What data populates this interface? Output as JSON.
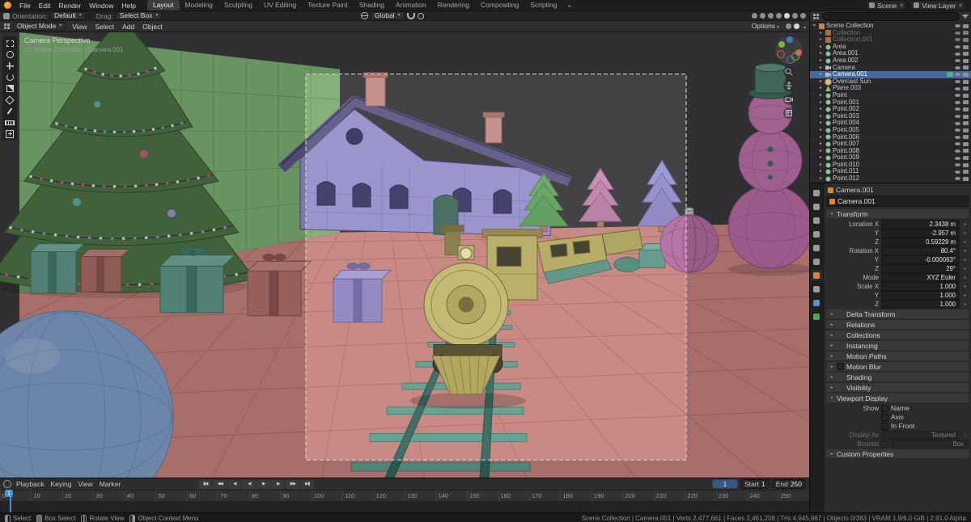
{
  "topbar": {
    "menus": [
      {
        "label": "File"
      },
      {
        "label": "Edit"
      },
      {
        "label": "Render"
      },
      {
        "label": "Window"
      },
      {
        "label": "Help"
      }
    ],
    "workspaces": [
      {
        "label": "Layout",
        "cls": "active"
      },
      {
        "label": "Modeling",
        "cls": ""
      },
      {
        "label": "Sculpting",
        "cls": ""
      },
      {
        "label": "UV Editing",
        "cls": ""
      },
      {
        "label": "Texture Paint",
        "cls": ""
      },
      {
        "label": "Shading",
        "cls": ""
      },
      {
        "label": "Animation",
        "cls": ""
      },
      {
        "label": "Rendering",
        "cls": ""
      },
      {
        "label": "Compositing",
        "cls": ""
      },
      {
        "label": "Scripting",
        "cls": ""
      }
    ],
    "add_workspace": "+",
    "scene_label": "Scene",
    "view_layer_label": "View Layer",
    "clear_glyph": "✕"
  },
  "tool_settings": {
    "orientation_label": "Orientation:",
    "orientation_value": "Default",
    "drag_label": "Drag:",
    "drag_value": "Select Box",
    "transform_orientation": "Global",
    "right_icons": [
      {
        "name": "show-gizmo-icon",
        "cls": ""
      },
      {
        "name": "show-overlays-icon",
        "cls": ""
      },
      {
        "name": "toggle-xray-icon",
        "cls": ""
      },
      {
        "name": "shading-wireframe-icon",
        "cls": ""
      },
      {
        "name": "shading-solid-icon",
        "cls": "on"
      },
      {
        "name": "shading-material-icon",
        "cls": ""
      },
      {
        "name": "shading-rendered-icon",
        "cls": ""
      }
    ]
  },
  "viewport_header": {
    "mode": "Object Mode",
    "menus": [
      {
        "label": "View"
      },
      {
        "label": "Select"
      },
      {
        "label": "Add"
      },
      {
        "label": "Object"
      }
    ],
    "options_label": "Options"
  },
  "toolbar": {
    "tools": [
      {
        "name": "select-box",
        "cls": "t-select-box"
      },
      {
        "name": "cursor",
        "cls": "t-cursor"
      },
      {
        "name": "move",
        "cls": "t-move active-tool"
      },
      {
        "name": "rotate",
        "cls": "t-rotate"
      },
      {
        "name": "scale",
        "cls": "t-scale"
      },
      {
        "name": "transform",
        "cls": "t-transform"
      },
      {
        "name": "annotate",
        "cls": "t-annotate"
      },
      {
        "name": "measure",
        "cls": "t-measure"
      },
      {
        "name": "add-cube",
        "cls": "t-add-cube"
      }
    ]
  },
  "viewport": {
    "view_name": "Camera Perspective",
    "context": "(1) Scene Collection | Camera.001"
  },
  "outliner": {
    "rows": [
      {
        "label": "Scene Collection",
        "icon": "collection-icon",
        "tri": "▾",
        "pad": 2,
        "cls": "",
        "badge": ""
      },
      {
        "label": "Collection",
        "icon": "collection-icon",
        "tri": "▸",
        "pad": 10,
        "cls": "faded",
        "badge": ""
      },
      {
        "label": "Collection.001",
        "icon": "collection-icon",
        "tri": "▸",
        "pad": 10,
        "cls": "faded",
        "badge": ""
      },
      {
        "label": "Area",
        "icon": "light-icon",
        "tri": "▸",
        "pad": 10,
        "cls": "",
        "badge": ""
      },
      {
        "label": "Area.001",
        "icon": "light-icon",
        "tri": "▸",
        "pad": 10,
        "cls": "",
        "badge": ""
      },
      {
        "label": "Area.002",
        "icon": "light-icon",
        "tri": "▸",
        "pad": 10,
        "cls": "",
        "badge": ""
      },
      {
        "label": "Camera",
        "icon": "camera-icon",
        "tri": "▸",
        "pad": 10,
        "cls": "",
        "badge": ""
      },
      {
        "label": "Camera.001",
        "icon": "camera-icon",
        "tri": "▸",
        "pad": 10,
        "cls": "selected",
        "badge": "cam-active"
      },
      {
        "label": "Overcast Sun",
        "icon": "sun-icon",
        "tri": "▸",
        "pad": 10,
        "cls": "",
        "badge": ""
      },
      {
        "label": "Plane.003",
        "icon": "mesh-icon",
        "tri": "▸",
        "pad": 10,
        "cls": "",
        "badge": ""
      },
      {
        "label": "Point",
        "icon": "light-icon",
        "tri": "▸",
        "pad": 10,
        "cls": "",
        "badge": ""
      },
      {
        "label": "Point.001",
        "icon": "light-icon",
        "tri": "▸",
        "pad": 10,
        "cls": "",
        "badge": ""
      },
      {
        "label": "Point.002",
        "icon": "light-icon",
        "tri": "▸",
        "pad": 10,
        "cls": "",
        "badge": ""
      },
      {
        "label": "Point.003",
        "icon": "light-icon",
        "tri": "▸",
        "pad": 10,
        "cls": "",
        "badge": ""
      },
      {
        "label": "Point.004",
        "icon": "light-icon",
        "tri": "▸",
        "pad": 10,
        "cls": "",
        "badge": ""
      },
      {
        "label": "Point.005",
        "icon": "light-icon",
        "tri": "▸",
        "pad": 10,
        "cls": "",
        "badge": ""
      },
      {
        "label": "Point.006",
        "icon": "light-icon",
        "tri": "▸",
        "pad": 10,
        "cls": "",
        "badge": ""
      },
      {
        "label": "Point.007",
        "icon": "light-icon",
        "tri": "▸",
        "pad": 10,
        "cls": "",
        "badge": ""
      },
      {
        "label": "Point.008",
        "icon": "light-icon",
        "tri": "▸",
        "pad": 10,
        "cls": "",
        "badge": ""
      },
      {
        "label": "Point.009",
        "icon": "light-icon",
        "tri": "▸",
        "pad": 10,
        "cls": "",
        "badge": ""
      },
      {
        "label": "Point.010",
        "icon": "light-icon",
        "tri": "▸",
        "pad": 10,
        "cls": "",
        "badge": ""
      },
      {
        "label": "Point.011",
        "icon": "light-icon",
        "tri": "▸",
        "pad": 10,
        "cls": "",
        "badge": ""
      },
      {
        "label": "Point.012",
        "icon": "light-icon",
        "tri": "▸",
        "pad": 10,
        "cls": "",
        "badge": ""
      }
    ]
  },
  "properties": {
    "tabs": [
      {
        "name": "tool",
        "color": "#9a9a9a",
        "cls": ""
      },
      {
        "name": "render",
        "color": "#9a9a9a",
        "cls": ""
      },
      {
        "name": "output",
        "color": "#9a9a9a",
        "cls": ""
      },
      {
        "name": "view-layer",
        "color": "#9a9a9a",
        "cls": ""
      },
      {
        "name": "scene",
        "color": "#9a9a9a",
        "cls": ""
      },
      {
        "name": "world",
        "color": "#9a9a9a",
        "cls": ""
      },
      {
        "name": "object",
        "color": "#e0813c",
        "cls": "active"
      },
      {
        "name": "constraints",
        "color": "#9a9a9a",
        "cls": ""
      },
      {
        "name": "physics",
        "color": "#5d8fc0",
        "cls": ""
      },
      {
        "name": "object-data",
        "color": "#57a057",
        "cls": ""
      }
    ],
    "breadcrumb": "Camera.001",
    "object_name": "Camera.001",
    "transform_label": "Transform",
    "transform_rows": [
      {
        "label": "Location X",
        "value": "2.3438 m",
        "name": "location-x"
      },
      {
        "label": "Y",
        "value": "-2.957 m",
        "name": "location-y"
      },
      {
        "label": "Z",
        "value": "0.59229 m",
        "name": "location-z"
      },
      {
        "label": "Rotation X",
        "value": "80.4°",
        "name": "rotation-x"
      },
      {
        "label": "Y",
        "value": "-0.000063°",
        "name": "rotation-y"
      },
      {
        "label": "Z",
        "value": "29°",
        "name": "rotation-z"
      },
      {
        "label": "Mode",
        "value": "XYZ Euler",
        "name": "rotation-mode"
      },
      {
        "label": "Scale X",
        "value": "1.000",
        "name": "scale-x"
      },
      {
        "label": "Y",
        "value": "1.000",
        "name": "scale-y"
      },
      {
        "label": "Z",
        "value": "1.000",
        "name": "scale-z"
      }
    ],
    "sections_mid": [
      {
        "label": "Delta Transform",
        "chk": ""
      },
      {
        "label": "Relations",
        "chk": ""
      },
      {
        "label": "Collections",
        "chk": ""
      },
      {
        "label": "Instancing",
        "chk": ""
      },
      {
        "label": "Motion Paths",
        "chk": ""
      },
      {
        "label": "Motion Blur",
        "chk": "show"
      },
      {
        "label": "Shading",
        "chk": ""
      },
      {
        "label": "Visibility",
        "chk": ""
      }
    ],
    "viewport_display": {
      "label": "Viewport Display",
      "show_label": "Show",
      "name_label": "Name",
      "axis_label": "Axis",
      "in_front_label": "In Front",
      "display_as_label": "Display As",
      "display_as_value": "Textured",
      "bounds_label": "Bounds",
      "bounds_value": "Box"
    },
    "custom_properties_label": "Custom Properties"
  },
  "timeline": {
    "menus": [
      {
        "label": "Playback"
      },
      {
        "label": "Keying"
      },
      {
        "label": "View"
      },
      {
        "label": "Marker"
      }
    ],
    "transport": [
      {
        "name": "jump-start",
        "g": "▮◀"
      },
      {
        "name": "prev-keyframe",
        "g": "◀◀"
      },
      {
        "name": "prev-frame",
        "g": "◀"
      },
      {
        "name": "play-reverse",
        "g": "◀"
      },
      {
        "name": "play",
        "g": "▶"
      },
      {
        "name": "next-frame",
        "g": "▶"
      },
      {
        "name": "next-keyframe",
        "g": "▶▶"
      },
      {
        "name": "jump-end",
        "g": "▶▮"
      }
    ],
    "current_frame": "1",
    "start_label": "Start",
    "start_value": "1",
    "end_label": "End",
    "end_value": "250",
    "frames": [
      "0",
      "10",
      "20",
      "30",
      "40",
      "50",
      "60",
      "70",
      "80",
      "90",
      "100",
      "110",
      "120",
      "130",
      "140",
      "150",
      "160",
      "170",
      "180",
      "190",
      "200",
      "210",
      "220",
      "230",
      "240",
      "250"
    ]
  },
  "statusbar": {
    "left": [
      {
        "label": "Select",
        "mcls": "ml",
        "name": "mouse-left-icon"
      },
      {
        "label": "Box Select",
        "mcls": "md",
        "name": "mouse-drag-icon"
      },
      {
        "label": "Rotate View",
        "mcls": "mm",
        "name": "mouse-middle-icon"
      },
      {
        "label": "Object Context Menu",
        "mcls": "mr",
        "name": "mouse-right-icon"
      }
    ],
    "right": "Scene Collection | Camera.001 | Verts 2,477,661 | Faces 2,461,208 | Tris 4,945,967 | Objects 0/383 | VRAM 1.9/6.0 GiB | 2.91.0 Alpha"
  }
}
